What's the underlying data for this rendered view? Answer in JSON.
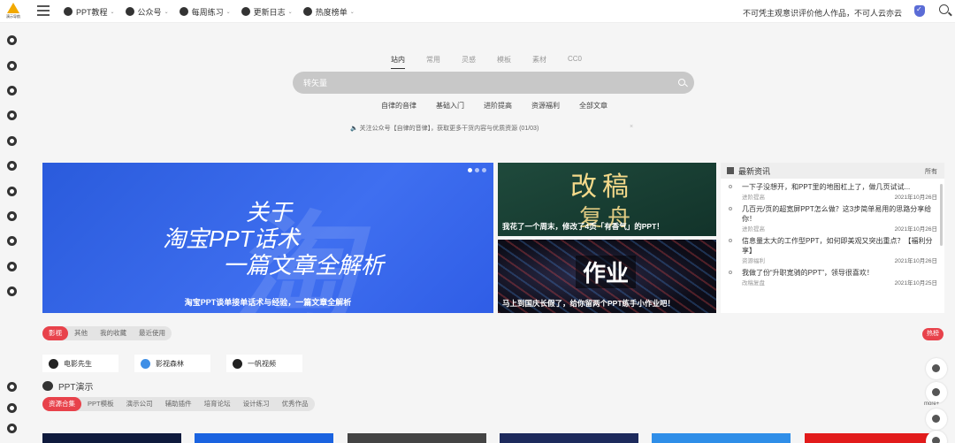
{
  "header": {
    "logo_text": "演示导航",
    "nav": [
      {
        "label": "PPT教程",
        "icon": "ppt-icon"
      },
      {
        "label": "公众号",
        "icon": "wechat-icon"
      },
      {
        "label": "每周练习",
        "icon": "practice-icon"
      },
      {
        "label": "更新日志",
        "icon": "log-icon"
      },
      {
        "label": "热度榜单",
        "icon": "fire-icon"
      }
    ],
    "slogan": "不可凭主观意识评价他人作品，不可人云亦云"
  },
  "search": {
    "tabs": [
      "站内",
      "常用",
      "灵感",
      "模板",
      "素材",
      "CC0"
    ],
    "active_tab": "站内",
    "placeholder": "转矢量",
    "quick_links": [
      "自律的音律",
      "基础入门",
      "进阶提高",
      "资源福利",
      "全部文章"
    ],
    "notice": "🔈 关注公众号【自律的音律】，获取更多干货内容与优质资源 (01/03)",
    "notice_close": "×"
  },
  "banner": {
    "bg_char": "淘",
    "line1": "关于",
    "line2": "淘宝PPT话术",
    "line3": "一篇文章全解析",
    "caption": "淘宝PPT谈单接单话术与经验，一篇文章全解析"
  },
  "cards": [
    {
      "line1": "改稿",
      "line2": "复舟",
      "caption": "我花了一个周末，修改了4页「有香气」的PPT！"
    },
    {
      "line1": "作业",
      "caption": "马上到国庆长假了，给你留两个PPT练手小作业吧！"
    }
  ],
  "news": {
    "title": "最新资讯",
    "all_label": "所有",
    "items": [
      {
        "text": "一下子没想开，和PPT里的地图杠上了，做几页试试...",
        "category": "进阶提高",
        "date": "2021年10月26日"
      },
      {
        "text": "几百元/页的超宽屏PPT怎么做？这3步简单易用的思路分享给你！",
        "category": "进阶提高",
        "date": "2021年10月26日"
      },
      {
        "text": "信息量太大的工作型PPT，如何即美观又突出重点？【福利分享】",
        "category": "资源福利",
        "date": "2021年10月26日"
      },
      {
        "text": "我做了份“升职宽骑的PPT”，领导很喜欢！",
        "category": "改稿复盘",
        "date": "2021年10月25日"
      }
    ]
  },
  "filter": {
    "tabs": [
      "影视",
      "其他",
      "我的收藏",
      "最近使用"
    ],
    "active": "影视",
    "hot_label": "热榜"
  },
  "links": [
    {
      "label": "电影先生",
      "icon": "globe-icon"
    },
    {
      "label": "影视森林",
      "icon": "vshield-icon"
    },
    {
      "label": "一帆视频",
      "icon": "globe-icon"
    }
  ],
  "ppt_section": {
    "title": "PPT演示",
    "tabs": [
      "资源合集",
      "PPT模板",
      "演示公司",
      "辅助插件",
      "培育论坛",
      "设计练习",
      "优秀作品"
    ],
    "active": "资源合集"
  },
  "thumbs_colors": [
    "#0f1a3d",
    "#1a63e0",
    "#444444",
    "#1d2a5c",
    "#2f8ee8",
    "#e21b1b"
  ],
  "more_label": "more+"
}
